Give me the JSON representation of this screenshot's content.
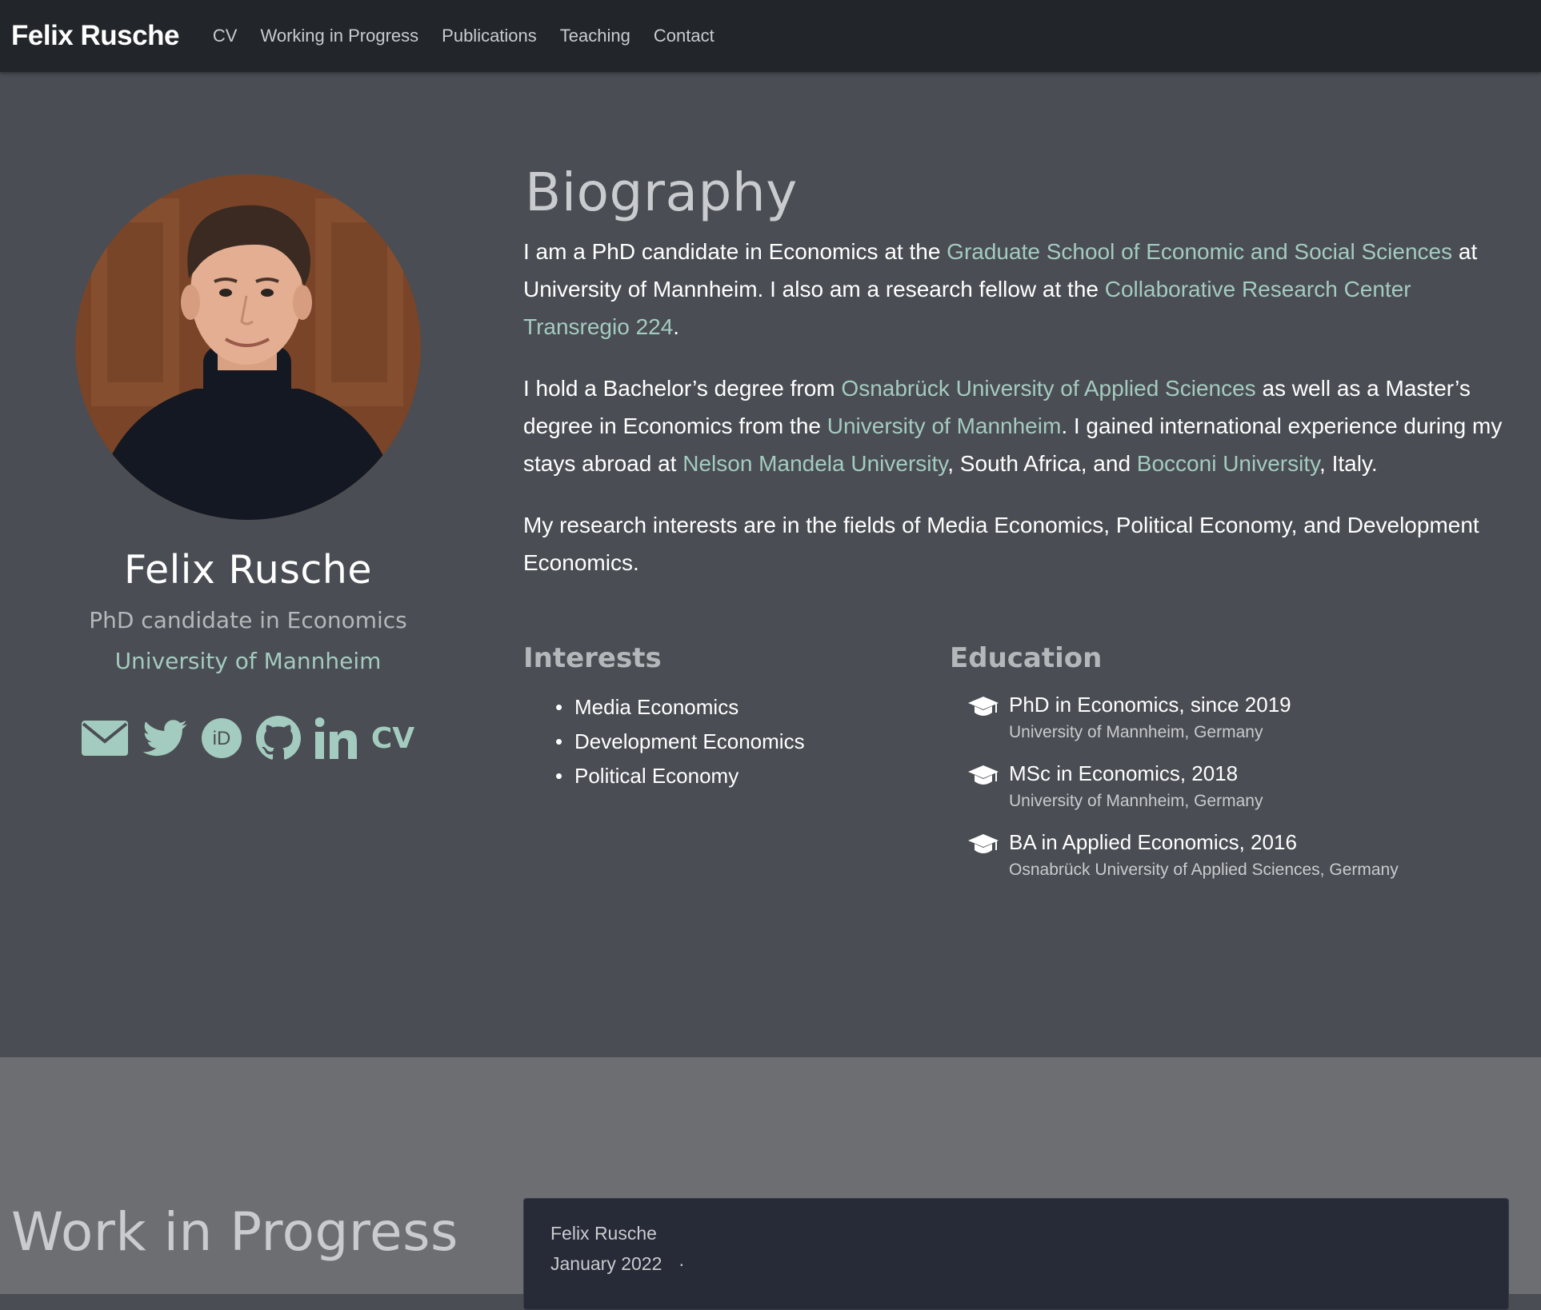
{
  "nav": {
    "brand": "Felix Rusche",
    "links": [
      "CV",
      "Working in Progress",
      "Publications",
      "Teaching",
      "Contact"
    ]
  },
  "profile": {
    "name": "Felix Rusche",
    "role": "PhD candidate in Economics",
    "affiliation": "University of Mannheim",
    "social_icons": [
      "envelope-icon",
      "twitter-icon",
      "orcid-icon",
      "github-icon",
      "linkedin-icon",
      "cv-icon"
    ],
    "cv_label": "CV"
  },
  "biography": {
    "title": "Biography",
    "p1": {
      "t1": "I am a PhD candidate in Economics at the ",
      "link1": "Graduate School of Economic and Social Sciences",
      "t2": " at University of Mannheim. I also am a research fellow at the ",
      "link2": "Collaborative Research Center Transregio 224",
      "t3": "."
    },
    "p2": {
      "t1": "I hold a Bachelor’s degree from ",
      "link1": "Osnabrück University of Applied Sciences",
      "t2": " as well as a Master’s degree in Economics from the ",
      "link2": "University of Mannheim",
      "t3": ". I gained international experience during my stays abroad at ",
      "link3": "Nelson Mandela University",
      "t4": ", South Africa, and ",
      "link4": "Bocconi University",
      "t5": ", Italy."
    },
    "p3": "My research interests are in the fields of Media Economics, Political Economy, and Development Economics."
  },
  "interests": {
    "title": "Interests",
    "items": [
      "Media Economics",
      "Development Economics",
      "Political Economy"
    ]
  },
  "education": {
    "title": "Education",
    "items": [
      {
        "course": "PhD in Economics, since 2019",
        "institution": "University of Mannheim, Germany"
      },
      {
        "course": "MSc in Economics, 2018",
        "institution": "University of Mannheim, Germany"
      },
      {
        "course": "BA in Applied Economics, 2016",
        "institution": "Osnabrück University of Applied Sciences, Germany"
      }
    ]
  },
  "wip": {
    "title": "Work in Progress",
    "card": {
      "author": "Felix Rusche",
      "date": "January 2022",
      "separator": "·"
    }
  },
  "colors": {
    "accent": "#a4cbbf",
    "navbar": "#22262a",
    "about_bg": "#4a4d53",
    "wip_bg": "#6c6e72",
    "card_bg": "#272a37"
  }
}
